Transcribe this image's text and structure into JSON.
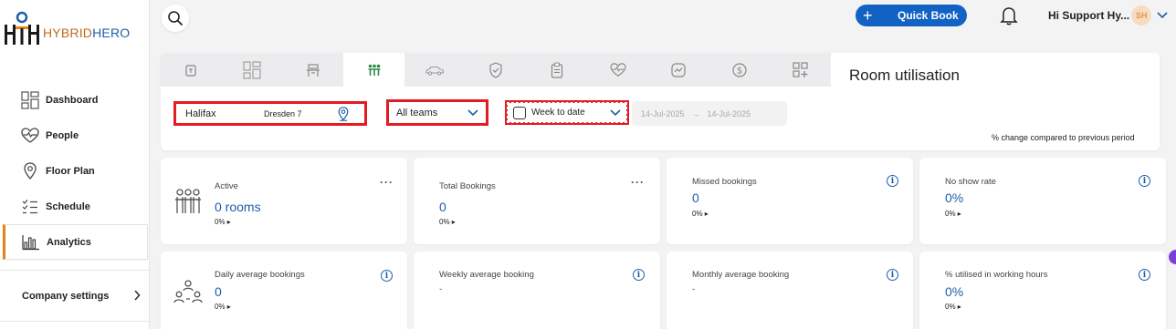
{
  "app": {
    "logo_part1": "HYBRID",
    "logo_part2": "HERO",
    "brand_orange": "#c06a1d",
    "brand_blue": "#1e5ea8"
  },
  "sidebar": {
    "items": [
      {
        "label": "Dashboard",
        "icon": "dashboard-icon"
      },
      {
        "label": "People",
        "icon": "heart-pulse-icon"
      },
      {
        "label": "Floor Plan",
        "icon": "map-pin-icon"
      },
      {
        "label": "Schedule",
        "icon": "checklist-icon"
      },
      {
        "label": "Analytics",
        "icon": "bar-chart-icon",
        "active": true
      }
    ],
    "company_settings": "Company settings"
  },
  "topbar": {
    "quick_book": "Quick Book",
    "user_greeting": "Hi Support Hy...",
    "avatar_initials": "SH"
  },
  "filters": {
    "tabs": [
      "building-icon",
      "layout-icon",
      "desk-icon",
      "meeting-room-icon",
      "car-icon",
      "shield-icon",
      "clipboard-icon",
      "heart-pulse-icon",
      "activity-icon",
      "dollar-icon",
      "add-grid-icon"
    ],
    "active_tab": 3,
    "title": "Room utilisation",
    "location": "Halifax",
    "location_sub": "Dresden 7",
    "teams": "All teams",
    "period": "Week to date",
    "date_from": "14-Jul-2025",
    "date_to": "14-Jul-2025",
    "comparison_note": "% change compared to previous period"
  },
  "cards": {
    "active": {
      "title": "Active",
      "value": "0 rooms",
      "pct": "0%"
    },
    "total_bookings": {
      "title": "Total Bookings",
      "value": "0",
      "pct": "0%"
    },
    "missed_bookings": {
      "title": "Missed bookings",
      "value": "0",
      "pct": "0%"
    },
    "no_show_rate": {
      "title": "No show rate",
      "value": "0%",
      "pct": "0%"
    },
    "daily_avg": {
      "title": "Daily average bookings",
      "value": "0",
      "pct": "0%"
    },
    "weekly_avg": {
      "title": "Weekly average booking",
      "value": "-"
    },
    "monthly_avg": {
      "title": "Monthly average booking",
      "value": "-"
    },
    "utilised": {
      "title": "% utilised in working hours",
      "value": "0%",
      "pct": "0%"
    }
  }
}
